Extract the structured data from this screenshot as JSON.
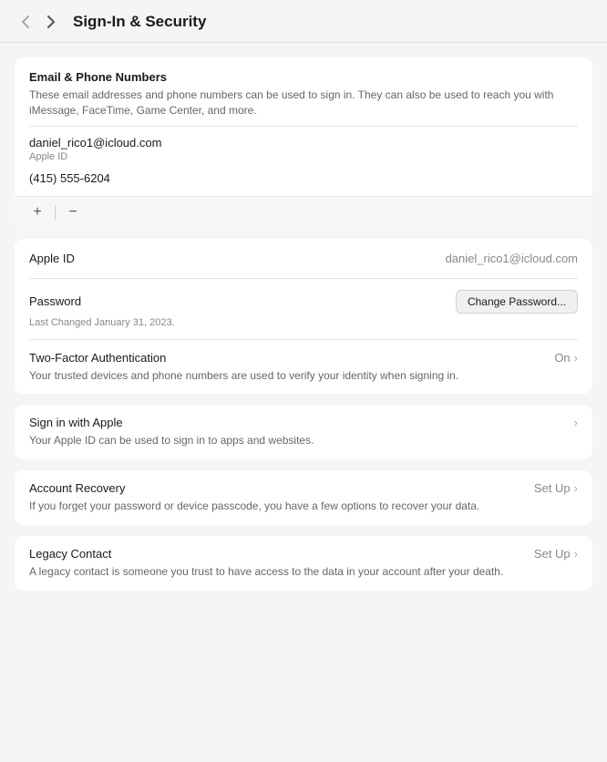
{
  "header": {
    "title": "Sign-In & Security",
    "back_icon": "‹",
    "forward_icon": "›"
  },
  "email_phone_section": {
    "title": "Email & Phone Numbers",
    "description": "These email addresses and phone numbers can be used to sign in. They can also be used to reach you with iMessage, FaceTime, Game Center, and more.",
    "email": "daniel_rico1@icloud.com",
    "apple_id_label": "Apple ID",
    "phone": "(415) 555-6204",
    "add_icon": "+",
    "remove_icon": "−"
  },
  "apple_id_row": {
    "label": "Apple ID",
    "value": "daniel_rico1@icloud.com"
  },
  "password_section": {
    "label": "Password",
    "last_changed": "Last Changed January 31, 2023.",
    "change_button": "Change Password..."
  },
  "tfa_section": {
    "label": "Two-Factor Authentication",
    "status": "On",
    "description": "Your trusted devices and phone numbers are used to verify your identity when signing in."
  },
  "siwa_section": {
    "label": "Sign in with Apple",
    "description": "Your Apple ID can be used to sign in to apps and websites."
  },
  "recovery_section": {
    "label": "Account Recovery",
    "setup": "Set Up",
    "description": "If you forget your password or device passcode, you have a few options to recover your data."
  },
  "legacy_section": {
    "label": "Legacy Contact",
    "setup": "Set Up",
    "description": "A legacy contact is someone you trust to have access to the data in your account after your death."
  }
}
